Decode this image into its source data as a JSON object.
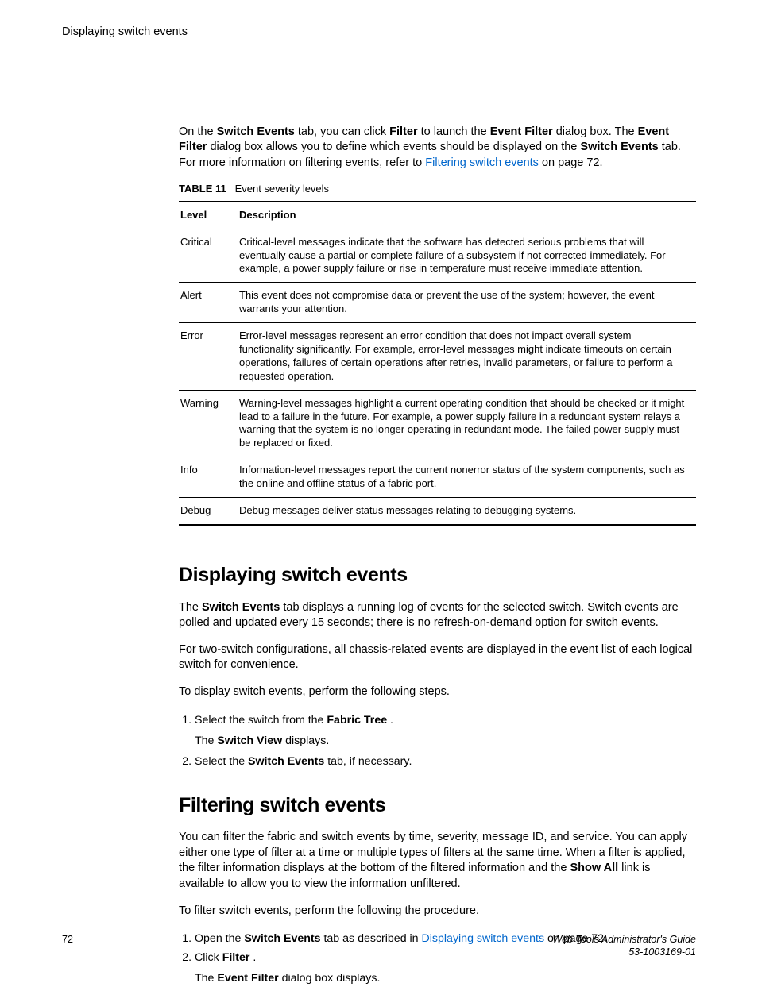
{
  "running_head": "Displaying switch events",
  "intro": {
    "p1_a": "On the ",
    "p1_b": "Switch Events",
    "p1_c": " tab, you can click ",
    "p1_d": "Filter",
    "p1_e": " to launch the ",
    "p1_f": "Event Filter",
    "p1_g": " dialog box. The ",
    "p1_h": "Event Filter",
    "p1_i": " dialog box allows you to define which events should be displayed on the ",
    "p1_j": "Switch Events",
    "p1_k": " tab. For more information on filtering events, refer to ",
    "p1_link": "Filtering switch events",
    "p1_l": " on page 72."
  },
  "table": {
    "label": "TABLE 11",
    "caption": "Event severity levels",
    "head_level": "Level",
    "head_desc": "Description",
    "rows": [
      {
        "level": "Critical",
        "desc": "Critical-level messages indicate that the software has detected serious problems that will eventually cause a partial or complete failure of a subsystem if not corrected immediately. For example, a power supply failure or rise in temperature must receive immediate attention."
      },
      {
        "level": "Alert",
        "desc": "This event does not compromise data or prevent the use of the system; however, the event warrants your attention."
      },
      {
        "level": "Error",
        "desc": "Error-level messages represent an error condition that does not impact overall system functionality significantly. For example, error-level messages might indicate timeouts on certain operations, failures of certain operations after retries, invalid parameters, or failure to perform a requested operation."
      },
      {
        "level": "Warning",
        "desc": "Warning-level messages highlight a current operating condition that should be checked or it might lead to a failure in the future. For example, a power supply failure in a redundant system relays a warning that the system is no longer operating in redundant mode. The failed power supply must be replaced or fixed."
      },
      {
        "level": "Info",
        "desc": "Information-level messages report the current nonerror status of the system components, such as the online and offline status of a fabric port."
      },
      {
        "level": "Debug",
        "desc": "Debug messages deliver status messages relating to debugging systems."
      }
    ]
  },
  "sec1": {
    "title": "Displaying switch events",
    "p1_a": "The ",
    "p1_b": "Switch Events",
    "p1_c": " tab displays a running log of events for the selected switch. Switch events are polled and updated every 15 seconds; there is no refresh-on-demand option for switch events.",
    "p2": "For two-switch configurations, all chassis-related events are displayed in the event list of each logical switch for convenience.",
    "p3": "To display switch events, perform the following steps.",
    "s1_a": "Select the switch from the ",
    "s1_b": "Fabric Tree",
    "s1_c": " .",
    "s1_sub_a": "The ",
    "s1_sub_b": "Switch View",
    "s1_sub_c": " displays.",
    "s2_a": "Select the ",
    "s2_b": "Switch Events",
    "s2_c": " tab, if necessary."
  },
  "sec2": {
    "title": "Filtering switch events",
    "p1_a": "You can filter the fabric and switch events by time, severity, message ID, and service. You can apply either one type of filter at a time or multiple types of filters at the same time. When a filter is applied, the filter information displays at the bottom of the filtered information and the ",
    "p1_b": "Show All",
    "p1_c": " link is available to allow you to view the information unfiltered.",
    "p2": "To filter switch events, perform the following the procedure.",
    "s1_a": "Open the ",
    "s1_b": "Switch Events",
    "s1_c": " tab as described in ",
    "s1_link": "Displaying switch events",
    "s1_d": " on page 72.",
    "s2_a": "Click ",
    "s2_b": "Filter",
    "s2_c": " .",
    "s2_sub_a": "The ",
    "s2_sub_b": "Event Filter",
    "s2_sub_c": " dialog box displays."
  },
  "footer": {
    "page": "72",
    "title": "Web Tools Administrator's Guide",
    "docno": "53-1003169-01"
  }
}
